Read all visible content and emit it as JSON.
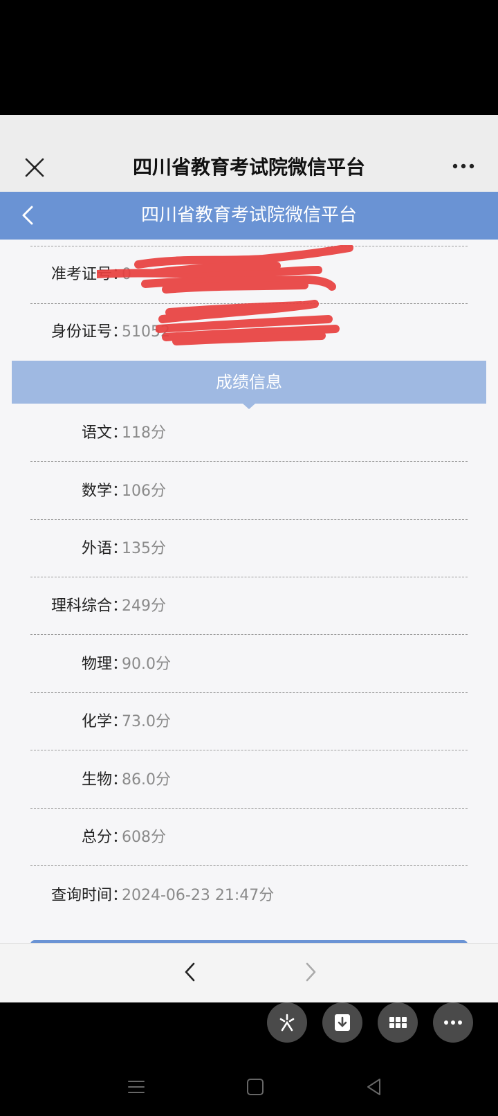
{
  "wechat_bar": {
    "title": "四川省教育考试院微信平台",
    "close_icon": "close-icon",
    "more_icon": "more-dots-icon"
  },
  "page_header": {
    "title": "四川省教育考试院微信平台",
    "back_icon": "chevron-left-icon"
  },
  "identity": {
    "admission_ticket": {
      "label": "准考证号",
      "value": "0"
    },
    "id_number": {
      "label": "身份证号",
      "value": "51052"
    }
  },
  "section": {
    "title": "成绩信息"
  },
  "scores": [
    {
      "label": "语文",
      "value": "118分"
    },
    {
      "label": "数学",
      "value": "106分"
    },
    {
      "label": "外语",
      "value": "135分"
    },
    {
      "label": "理科综合",
      "value": "249分"
    },
    {
      "label": "物理",
      "value": "90.0分"
    },
    {
      "label": "化学",
      "value": "73.0分"
    },
    {
      "label": "生物",
      "value": "86.0分"
    },
    {
      "label": "总分",
      "value": "608分"
    },
    {
      "label": "查询时间",
      "value": "2024-06-23 21:47分"
    }
  ],
  "colon": "：",
  "colors": {
    "header_blue": "#6a93d4",
    "section_blue": "#9fb9e2",
    "redaction_red": "#e8403f"
  },
  "browser_nav": {
    "back_icon": "chevron-left-icon",
    "forward_icon": "chevron-right-icon"
  },
  "toolbar": {
    "icons": [
      "sparkle-icon",
      "download-icon",
      "grid-icon",
      "more-dots-icon"
    ]
  },
  "system_nav": {
    "icons": [
      "menu-icon",
      "home-square-icon",
      "back-triangle-icon"
    ]
  }
}
